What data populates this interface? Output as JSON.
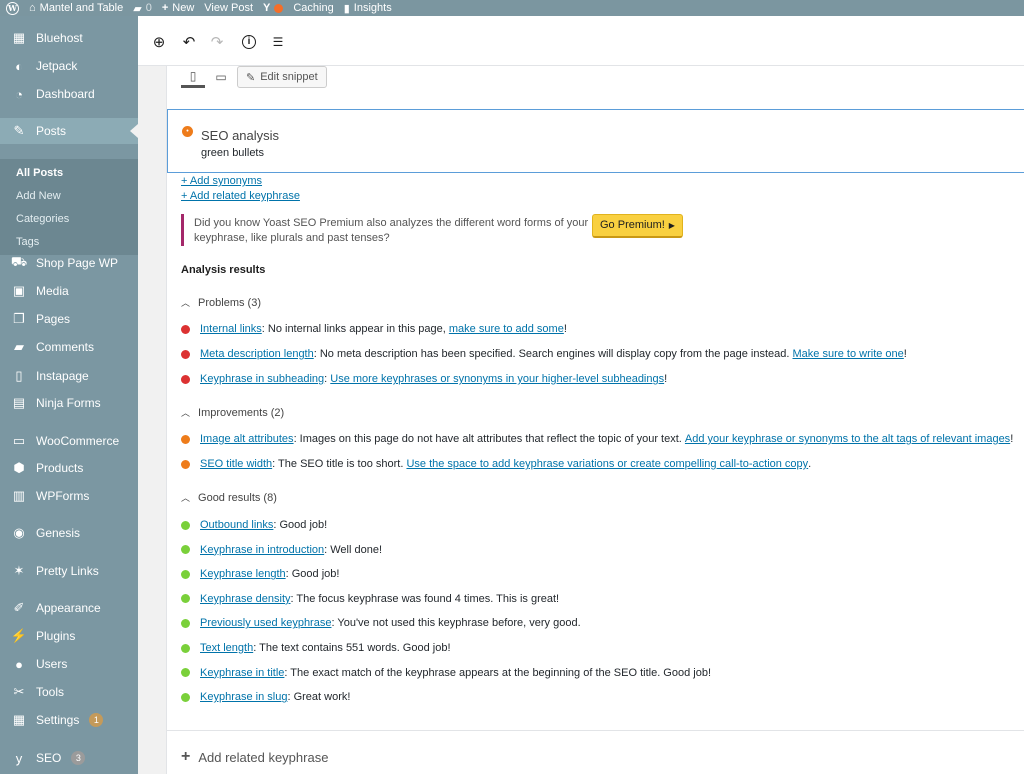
{
  "admin_bar": {
    "site_name": "Mantel and Table",
    "comments_count": "0",
    "new_label": "New",
    "view_post_label": "View Post",
    "caching_label": "Caching",
    "insights_label": "Insights"
  },
  "sidebar": {
    "items": [
      {
        "label": "Bluehost",
        "icon": "grid-icon",
        "glyph": "▦"
      },
      {
        "label": "Jetpack",
        "icon": "jetpack-icon",
        "glyph": "◐"
      },
      {
        "label": "Dashboard",
        "icon": "dashboard-icon",
        "glyph": "◔"
      },
      {
        "label": "Posts",
        "icon": "pin-icon",
        "glyph": "✎"
      },
      {
        "label": "Shop Page WP",
        "icon": "cart-icon",
        "glyph": "⛟"
      },
      {
        "label": "Media",
        "icon": "media-icon",
        "glyph": "▣"
      },
      {
        "label": "Pages",
        "icon": "pages-icon",
        "glyph": "❐"
      },
      {
        "label": "Comments",
        "icon": "comments-icon",
        "glyph": "▰"
      },
      {
        "label": "Instapage",
        "icon": "instapage-icon",
        "glyph": "▯"
      },
      {
        "label": "Ninja Forms",
        "icon": "forms-icon",
        "glyph": "▤"
      },
      {
        "label": "WooCommerce",
        "icon": "woo-icon",
        "glyph": "▭"
      },
      {
        "label": "Products",
        "icon": "box-icon",
        "glyph": "⬢"
      },
      {
        "label": "WPForms",
        "icon": "wpforms-icon",
        "glyph": "▥"
      },
      {
        "label": "Genesis",
        "icon": "genesis-icon",
        "glyph": "◉"
      },
      {
        "label": "Pretty Links",
        "icon": "star-link-icon",
        "glyph": "✶"
      },
      {
        "label": "Appearance",
        "icon": "brush-icon",
        "glyph": "✐"
      },
      {
        "label": "Plugins",
        "icon": "plug-icon",
        "glyph": "⚡"
      },
      {
        "label": "Users",
        "icon": "user-icon",
        "glyph": "●"
      },
      {
        "label": "Tools",
        "icon": "wrench-icon",
        "glyph": "✂"
      },
      {
        "label": "Settings",
        "icon": "settings-icon",
        "glyph": "▦",
        "badge": "1"
      },
      {
        "label": "SEO",
        "icon": "yoast-icon",
        "glyph": "y",
        "badge": "3"
      }
    ],
    "submenu": {
      "all_posts": "All Posts",
      "add_new": "Add New",
      "categories": "Categories",
      "tags": "Tags"
    }
  },
  "toolbar": {
    "add_block": "⊕",
    "undo": "↶",
    "redo": "↷",
    "info": "i",
    "outline": "☰"
  },
  "snippet": {
    "edit_snippet_label": "Edit snippet"
  },
  "seo_analysis": {
    "title": "SEO analysis",
    "keyphrase": "green bullets",
    "add_synonyms": "+ Add synonyms",
    "add_related": "+ Add related keyphrase"
  },
  "premium": {
    "text": "Did you know Yoast SEO Premium also analyzes the different word forms of your keyphrase, like plurals and past tenses?",
    "button": "Go Premium!"
  },
  "analysis": {
    "title": "Analysis results",
    "problems_label": "Problems (3)",
    "improvements_label": "Improvements (2)",
    "good_label": "Good results (8)",
    "problems": [
      {
        "link": "Internal links",
        "text": ": No internal links appear in this page, ",
        "link2": "make sure to add some",
        "tail": "!"
      },
      {
        "link": "Meta description length",
        "text": ": No meta description has been specified. Search engines will display copy from the page instead. ",
        "link2": "Make sure to write one",
        "tail": "!"
      },
      {
        "link": "Keyphrase in subheading",
        "text": ": ",
        "link2": "Use more keyphrases or synonyms in your higher-level subheadings",
        "tail": "!"
      }
    ],
    "improvements": [
      {
        "link": "Image alt attributes",
        "text": ": Images on this page do not have alt attributes that reflect the topic of your text. ",
        "link2": "Add your keyphrase or synonyms to the alt tags of relevant images",
        "tail": "!"
      },
      {
        "link": "SEO title width",
        "text": ": The SEO title is too short. ",
        "link2": "Use the space to add keyphrase variations or create compelling call-to-action copy",
        "tail": "."
      }
    ],
    "good": [
      {
        "link": "Outbound links",
        "text": ": Good job!"
      },
      {
        "link": "Keyphrase in introduction",
        "text": ": Well done!"
      },
      {
        "link": "Keyphrase length",
        "text": ": Good job!"
      },
      {
        "link": "Keyphrase density",
        "text": ": The focus keyphrase was found 4 times. This is great!"
      },
      {
        "link": "Previously used keyphrase",
        "text": ": You've not used this keyphrase before, very good."
      },
      {
        "link": "Text length",
        "text": ": The text contains 551 words. Good job!"
      },
      {
        "link": "Keyphrase in title",
        "text": ": The exact match of the keyphrase appears at the beginning of the SEO title. Good job!"
      },
      {
        "link": "Keyphrase in slug",
        "text": ": Great work!"
      }
    ]
  },
  "bottom": {
    "add_related_label": "Add related keyphrase"
  },
  "colors": {
    "sidebar_bg": "#7b97a2",
    "problem": "#dc3232",
    "improvement": "#ee7c1b",
    "good": "#7ad03a",
    "link": "#0073aa"
  }
}
